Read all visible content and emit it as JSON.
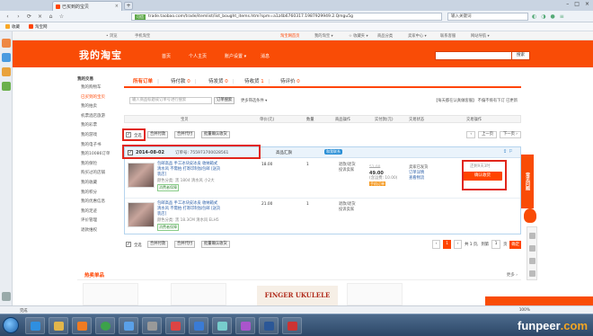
{
  "browser": {
    "tab_title": "已买到的宝贝",
    "tab_close": "×",
    "new_tab": "+",
    "window_buttons": [
      "–",
      "□",
      "×"
    ],
    "nav": {
      "back": "‹",
      "forward": "›",
      "reload": "⟳",
      "stop": "×",
      "home": "⌂",
      "star": "☆"
    },
    "address": "trade.taobao.com/trade/itemlist/list_bought_items.htm?spm=a1z4b6760317.1987929949.2.Qmgu5g",
    "address_badge": "可信",
    "search_text": "输入关键词",
    "tools": [
      "◐",
      "◑",
      "●",
      "≡"
    ],
    "bookmarks": [
      "收藏",
      "淘宝网"
    ]
  },
  "site_bar": {
    "left": [
      "•  浏览",
      "手机淘宝"
    ],
    "right": [
      "淘宝网首页",
      "我的淘宝 ▾",
      "☆ 收藏夹 ▾",
      "商品分类",
      "卖家中心 ▾",
      "联系客服",
      "网站导航 ▾"
    ]
  },
  "header": {
    "logo": "我的淘宝",
    "nav": [
      "首页",
      "个人主页",
      "账户设置 ▾",
      "消息"
    ],
    "search_button": "搜索"
  },
  "sidebar": {
    "title": "我的交易",
    "items": [
      "我的购物车",
      "已买到的宝贝",
      "我的拍卖",
      "机票酒店旅游",
      "我的彩票",
      "我的游戏",
      "我的电子书",
      "我的10086订单",
      "我的保险",
      "购买过的店铺",
      "我的收藏",
      "我的积分",
      "我的优惠信息",
      "我的足迹",
      "评价管理",
      "退款维权"
    ],
    "active_index": 1
  },
  "tabs": [
    {
      "label": "所有订单",
      "count": ""
    },
    {
      "label": "待付款",
      "count": "0"
    },
    {
      "label": "待发货",
      "count": "0"
    },
    {
      "label": "待收货",
      "count": "1"
    },
    {
      "label": "待评价",
      "count": "0"
    }
  ],
  "filters": {
    "search_placeholder": "输入商品标题或订单号进行搜索",
    "search_button": "订单搜索",
    "more": "更多筛选条件 ▾",
    "notice": "【每天都在认真做客服】 不偏不倚有下订 已更新"
  },
  "table_headers": [
    "宝贝",
    "单价(元)",
    "数量",
    "商品操作",
    "实付款(元)",
    "交易状态",
    "交易操作"
  ],
  "bulk_top": {
    "select_all": "全选",
    "buttons": [
      "合并付款",
      "合并代付",
      "批量确认收货"
    ],
    "pager": [
      "‹",
      "上一页",
      "下一页 ›"
    ]
  },
  "order": {
    "date": "2014-08-02",
    "order_no_label": "订单号:",
    "order_no": "755973700028561",
    "shop": "高品汇旗",
    "wangwang": "和我联系",
    "header_icons": "⇪  ⚐",
    "items": [
      {
        "name": "包邮高品 手工冰块皮冰皮 收纳箱式 清水风 不需拍 打寄印制加包邮 [送货装店]",
        "attr": "颜色分类: 黑 1804 清水风 小2大",
        "service": "消费者保障",
        "price": "18.00",
        "qty": "1",
        "ops": [
          "退款/退货",
          "投诉卖家"
        ]
      },
      {
        "name": "包邮高品 手工冰块皮冰皮 收纳箱式 清水风 不需拍 打寄印制加包邮 [送货装店]",
        "attr": "颜色分类: 黑 18.3CM 清水风 ELH5",
        "service": "消费者保障",
        "price": "21.00",
        "qty": "1",
        "ops": [
          "退款/退货",
          "投诉卖家"
        ]
      }
    ],
    "paid": {
      "original": "51.00",
      "total": "49.00",
      "shipping": "(含运费: 10.00)",
      "tag": "手机订单"
    },
    "status": [
      "卖家已发货",
      "订单详情",
      "查看物流"
    ],
    "actions": {
      "remaining": "还剩9天3时",
      "pay_button": "确认收货"
    }
  },
  "bulk_bottom": {
    "select_all": "全选",
    "buttons": [
      "合并付款",
      "合并代付",
      "批量确认收货"
    ],
    "pager": {
      "prev": "‹",
      "current": "1",
      "next": "›",
      "summary": "共 1 页,",
      "goto": "到第",
      "page_input": "1",
      "page_unit": "页",
      "go": "确定"
    }
  },
  "feedback_tab": "常见问题",
  "hot": {
    "title": "热卖单品",
    "more": "更多 ›",
    "ad_text": "FINGER UKULELE"
  },
  "statusbar": {
    "text": "完成",
    "zoom": "100%"
  },
  "watermark": {
    "a": "funpeer",
    "b": ".com"
  }
}
